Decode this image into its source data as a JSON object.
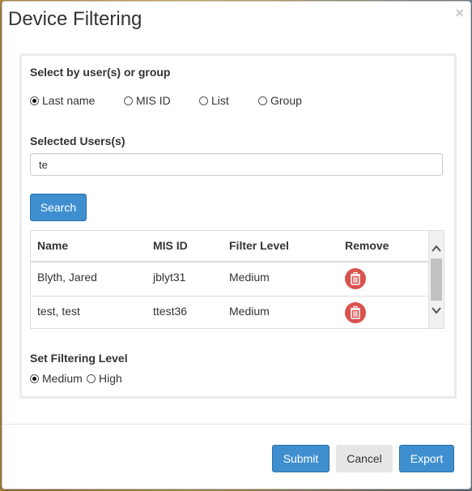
{
  "modal": {
    "title": "Device Filtering",
    "close": "×"
  },
  "select_section": {
    "label": "Select by user(s) or group",
    "options": [
      {
        "label": "Last name",
        "checked": true
      },
      {
        "label": "MIS ID",
        "checked": false
      },
      {
        "label": "List",
        "checked": false
      },
      {
        "label": "Group",
        "checked": false
      }
    ]
  },
  "selected_users": {
    "label": "Selected Users(s)",
    "value": "te"
  },
  "search_button": "Search",
  "table": {
    "headers": [
      "Name",
      "MIS ID",
      "Filter Level",
      "Remove"
    ],
    "rows": [
      {
        "name": "Blyth, Jared",
        "mis_id": "jblyt31",
        "filter_level": "Medium"
      },
      {
        "name": "test, test",
        "mis_id": "ttest36",
        "filter_level": "Medium"
      }
    ]
  },
  "filtering_level": {
    "label": "Set Filtering Level",
    "options": [
      {
        "label": "Medium",
        "checked": true
      },
      {
        "label": "High",
        "checked": false
      }
    ]
  },
  "footer": {
    "submit": "Submit",
    "cancel": "Cancel",
    "export": "Export"
  },
  "colors": {
    "primary": "#3f8fd0",
    "danger": "#d9534f",
    "default": "#e6e6e6"
  }
}
